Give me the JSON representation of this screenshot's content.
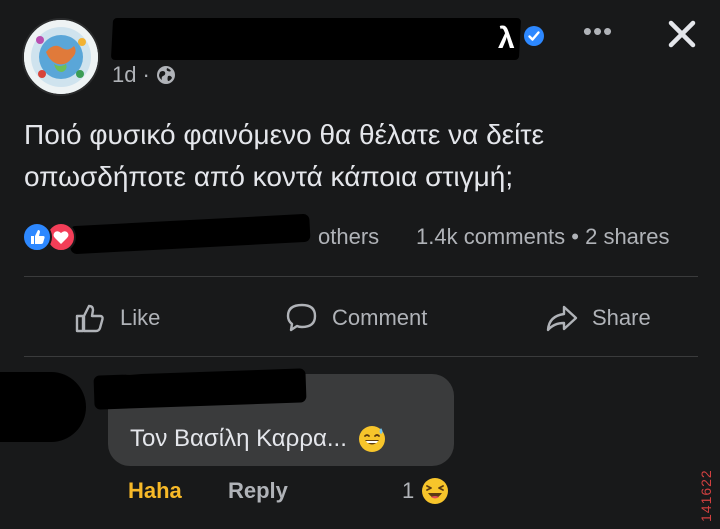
{
  "post": {
    "author_visible_suffix": "λ",
    "timestamp": "1d",
    "separator": "·",
    "privacy_icon": "globe-icon",
    "text_line1": "Ποιό φυσικό φαινόμενο θα θέλατε να δείτε",
    "text_line2": "οπωσδήποτε από κοντά κάποια στιγμή;"
  },
  "header": {
    "more_label": "•••",
    "more_icon": "more-dots-icon",
    "close_icon": "close-icon"
  },
  "stats": {
    "reactions": [
      "like-reaction-icon",
      "love-reaction-icon"
    ],
    "others_label": "others",
    "counts_label": "1.4k comments • 2 shares"
  },
  "actions": {
    "like_label": "Like",
    "comment_label": "Comment",
    "share_label": "Share"
  },
  "comment": {
    "text": "Τον Βασίλη Καρρα...",
    "emoji": "grinning-sweat-emoji",
    "haha_label": "Haha",
    "reply_label": "Reply",
    "reaction_count": "1",
    "reaction_emoji": "laughing-emoji"
  },
  "watermark": {
    "text": "141622"
  },
  "colors": {
    "background": "#18191a",
    "bubble": "#3a3b3c",
    "accent_blue": "#2d88ff",
    "haha_yellow": "#f7b928",
    "love_red": "#f33e58"
  }
}
